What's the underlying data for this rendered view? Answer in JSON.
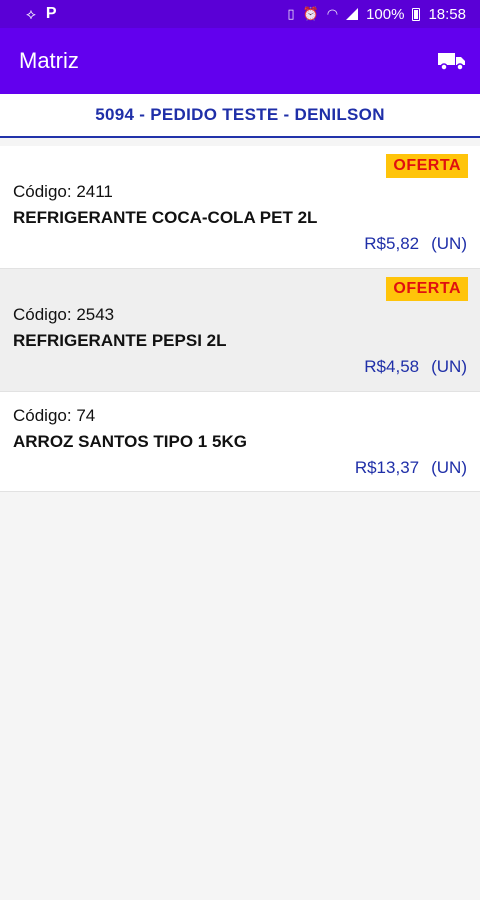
{
  "status_bar": {
    "time": "18:58",
    "battery": "100%",
    "app_notification": "P"
  },
  "app_bar": {
    "title": "Matriz",
    "action_icon": "truck-icon"
  },
  "order": {
    "title": "5094 - PEDIDO TESTE - DENILSON"
  },
  "products": [
    {
      "badge": "OFERTA",
      "code": "Código: 2411",
      "name": "REFRIGERANTE COCA-COLA PET 2L",
      "price": "R$5,82",
      "unit": "(UN)"
    },
    {
      "badge": "OFERTA",
      "code": "Código: 2543",
      "name": "REFRIGERANTE PEPSI  2L",
      "price": "R$4,58",
      "unit": "(UN)"
    },
    {
      "badge": "",
      "code": "Código: 74",
      "name": "ARROZ SANTOS TIPO 1 5KG",
      "price": "R$13,37",
      "unit": "(UN)"
    }
  ],
  "colors": {
    "primary": "#6200ee",
    "status_bar": "#5a00d6",
    "price_text": "#1f2fa8",
    "offer_bg": "#ffc40a",
    "offer_text": "#e01010"
  }
}
